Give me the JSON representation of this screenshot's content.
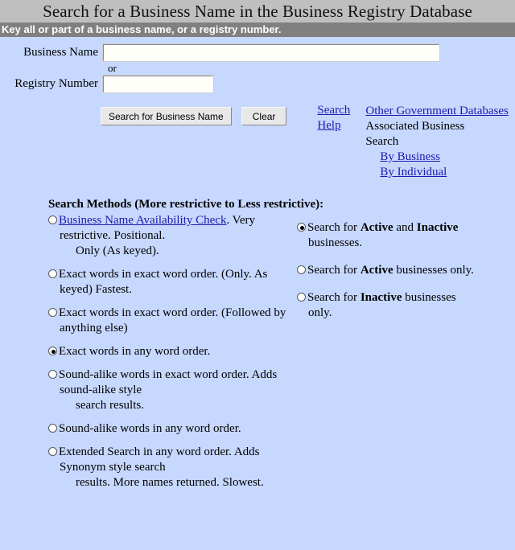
{
  "header": {
    "title": "Search for a Business Name in the Business Registry Database",
    "subtitle": "Key all or part of a business name, or a registry number."
  },
  "form": {
    "business_name_label": "Business Name",
    "business_name_value": "",
    "or_label": "or",
    "registry_number_label": "Registry Number",
    "registry_number_value": ""
  },
  "actions": {
    "search_button": "Search for Business Name",
    "clear_button": "Clear",
    "search_help_link": "Search Help",
    "other_databases_link": "Other Government Databases",
    "associated_business_line1": "Associated Business",
    "associated_business_line2": "Search",
    "by_business_link": "By Business",
    "by_individual_link": "By Individual"
  },
  "methods": {
    "heading": "Search Methods (More restrictive to Less restrictive):",
    "options": [
      {
        "link_label": "Business Name Availability Check",
        "text_after_link": ". Very restrictive. Positional.",
        "sub_text": "Only (As keyed).",
        "selected": false
      },
      {
        "label": "Exact words in exact word order. (Only. As keyed) Fastest.",
        "selected": false
      },
      {
        "label": "Exact words in exact word order. (Followed by anything else)",
        "selected": false
      },
      {
        "label": "Exact words in any word order.",
        "selected": true
      },
      {
        "label": "Sound-alike words in exact word order. Adds sound-alike style",
        "sub_text": "search results.",
        "selected": false
      },
      {
        "label": "Sound-alike words in any word order.",
        "selected": false
      },
      {
        "label": "Extended Search in any word order. Adds Synonym style search",
        "sub_text": "results. More names returned. Slowest.",
        "selected": false
      }
    ]
  },
  "status_filter": {
    "options": [
      {
        "pre": "Search for ",
        "bold1": "Active",
        "mid": " and ",
        "bold2": "Inactive",
        "post": " businesses.",
        "selected": true
      },
      {
        "pre": "Search for ",
        "bold1": "Active",
        "mid": "",
        "bold2": "",
        "post": " businesses only.",
        "selected": false
      },
      {
        "pre": "Search for ",
        "bold1": "Inactive",
        "mid": "",
        "bold2": "",
        "post": " businesses only.",
        "selected": false
      }
    ]
  },
  "colors": {
    "header_bg": "#bfbfbf",
    "subtitle_bg": "#808080",
    "body_bg": "#c7d8ff",
    "link": "#1a1ab0"
  }
}
